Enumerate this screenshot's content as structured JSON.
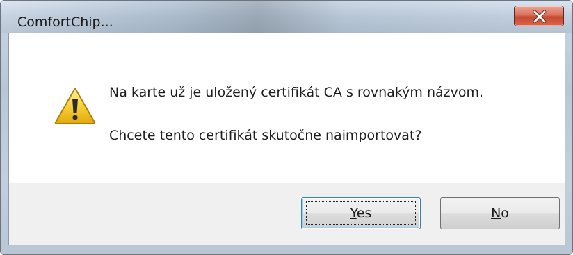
{
  "window": {
    "title": "ComfortChip..."
  },
  "close_button": {
    "icon": "close-icon"
  },
  "message": {
    "icon": "warning-icon",
    "line1": "Na karte už je uložený certifikát CA s rovnakým názvom.",
    "line2": "Chcete tento certifikát skutočne naimportovat?"
  },
  "buttons": {
    "yes": {
      "accel": "Y",
      "rest": "es"
    },
    "no": {
      "accel": "N",
      "rest": "o"
    }
  },
  "colors": {
    "close_button": "#c64a32",
    "warning_icon": "#f2c61f",
    "focus_border": "#3c7fb1"
  }
}
